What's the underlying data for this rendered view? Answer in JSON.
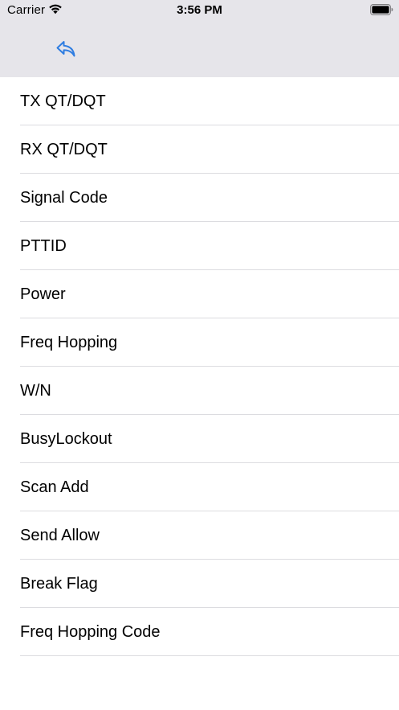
{
  "status_bar": {
    "carrier": "Carrier",
    "time": "3:56 PM",
    "wifi_icon": "wifi-icon",
    "battery_icon": "battery-full-icon"
  },
  "nav": {
    "back_icon": "reply-back-icon",
    "accent_color": "#2f7de1"
  },
  "colors": {
    "header_background": "#e6e5ea",
    "separator": "#dcdce0"
  },
  "menu": {
    "items": [
      {
        "label": "TX QT/DQT"
      },
      {
        "label": "RX QT/DQT"
      },
      {
        "label": "Signal Code"
      },
      {
        "label": "PTTID"
      },
      {
        "label": "Power"
      },
      {
        "label": "Freq Hopping"
      },
      {
        "label": "W/N"
      },
      {
        "label": "BusyLockout"
      },
      {
        "label": "Scan Add"
      },
      {
        "label": "Send Allow"
      },
      {
        "label": "Break Flag"
      },
      {
        "label": "Freq Hopping Code"
      }
    ]
  }
}
